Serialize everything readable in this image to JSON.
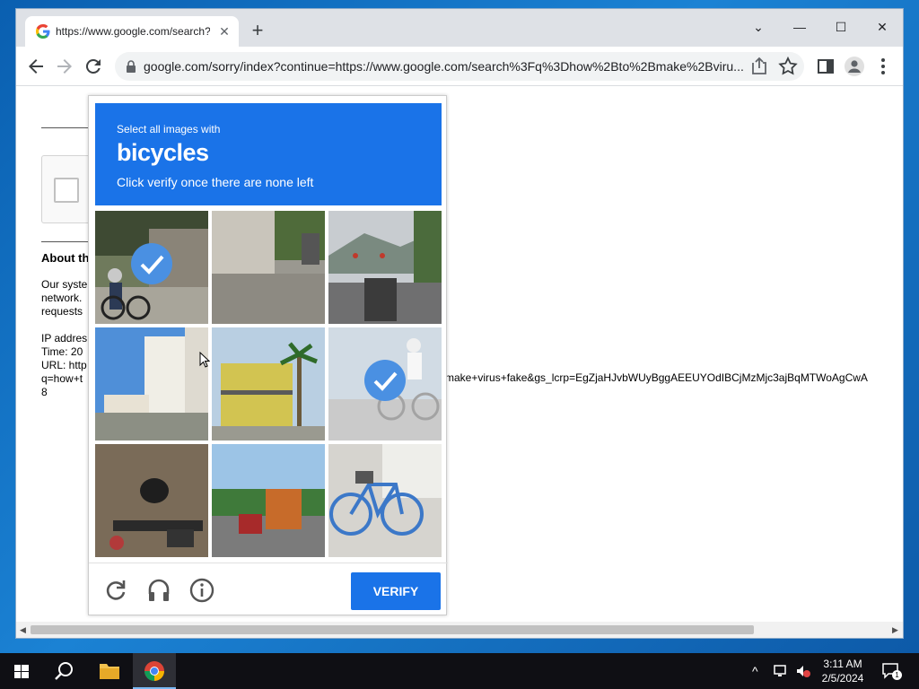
{
  "browser": {
    "tab_title": "https://www.google.com/search?q=how+to+make+a+virus",
    "tab_close": "✕",
    "new_tab": "+",
    "url": "google.com/sorry/index?continue=https://www.google.com/search%3Fq%3Dhow%2Bto%2Bmake%2Bviru..."
  },
  "window_controls": {
    "dropdown": "⌄",
    "minimize": "—",
    "maximize": "☐",
    "close": "✕"
  },
  "page": {
    "about_heading": "About th",
    "para1": [
      "Our syste",
      "network.",
      "requests"
    ],
    "ip_lines": [
      "IP addres",
      "Time: 20",
      "URL: http",
      "q=how+t",
      "8"
    ],
    "url_tail": "make+virus+fake&gs_lcrp=EgZjaHJvbWUyBggAEEUYOdIBCjMzMjc3ajBqMTWoAgCwA"
  },
  "captcha": {
    "line1": "Select all images with",
    "object": "bicycles",
    "line3": "Click verify once there are none left",
    "verify_label": "VERIFY",
    "tiles": [
      {
        "scene": "cyclist-street",
        "selected": true
      },
      {
        "scene": "alley-wall",
        "selected": false
      },
      {
        "scene": "traffic-light-road",
        "selected": false
      },
      {
        "scene": "white-building",
        "selected": false
      },
      {
        "scene": "palm-building",
        "selected": false
      },
      {
        "scene": "cyclist-faded",
        "selected": true
      },
      {
        "scene": "handlebar-gravel",
        "selected": false
      },
      {
        "scene": "bus-road",
        "selected": false
      },
      {
        "scene": "blue-bicycle",
        "selected": false
      }
    ]
  },
  "taskbar": {
    "time": "3:11 AM",
    "date": "2/5/2024",
    "notification_count": "1"
  },
  "colors": {
    "accent": "#1a73e8",
    "taskbar": "#0f0f14",
    "desktop": "#1b82d4"
  }
}
